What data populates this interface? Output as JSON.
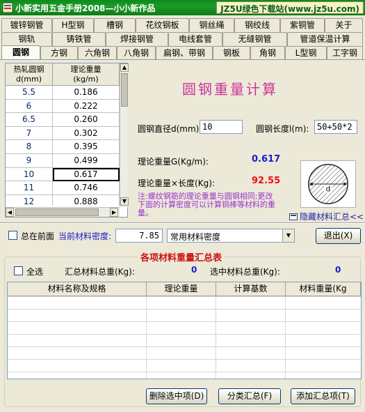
{
  "window": {
    "title": "小新实用五金手册2008—小小新作品",
    "site_badge": "JZ5U绿色下载站(www.jz5u.com)"
  },
  "tabs": {
    "row1": [
      "镀锌钢管",
      "H型钢",
      "槽钢",
      "花纹钢板",
      "钢丝绳",
      "钢绞线",
      "紫铜管",
      "关于"
    ],
    "row2": [
      "钢轨",
      "铸铁管",
      "焊接钢管",
      "电线套管",
      "无缝钢管",
      "管道保温计算"
    ],
    "row3": [
      "圆钢",
      "方钢",
      "六角钢",
      "八角钢",
      "扁钢、带钢",
      "钢板",
      "角钢",
      "L型钢",
      "工字钢"
    ],
    "active": "圆钢"
  },
  "table": {
    "col1_header": "热轧圆钢\nd(mm)",
    "col2_header": "理论重量\n(kg/m)",
    "rows": [
      {
        "d": "5.5",
        "w": "0.186"
      },
      {
        "d": "6",
        "w": "0.222"
      },
      {
        "d": "6.5",
        "w": "0.260"
      },
      {
        "d": "7",
        "w": "0.302"
      },
      {
        "d": "8",
        "w": "0.395"
      },
      {
        "d": "9",
        "w": "0.499"
      },
      {
        "d": "10",
        "w": "0.617"
      },
      {
        "d": "11",
        "w": "0.746"
      },
      {
        "d": "12",
        "w": "0.888"
      }
    ],
    "selected_row": 6
  },
  "calculator": {
    "title": "圆钢重量计算",
    "diameter_label": "圆钢直径d(mm):",
    "diameter_value": "10",
    "length_label": "圆钢长度l(m):",
    "length_value": "50+50*2",
    "theory_label": "理论重量G(Kg/m):",
    "theory_value": "0.617",
    "total_label": "理论重量×长度(Kg):",
    "total_value": "92.55",
    "note": "注:螺纹钢筋的理论重量与圆钢相同;更改下面的计算密度可以计算铜棒等材料的重量。",
    "diagram_label": "d",
    "hide_summary": "隐藏材料汇总<<"
  },
  "density": {
    "always_on_top": "总在前面",
    "label": "当前材料密度:",
    "value": "7.85",
    "select_value": "常用材料密度",
    "exit": "退出(X)"
  },
  "summary": {
    "title": "各项材料重量汇总表",
    "select_all": "全选",
    "total_label": "汇总材料总重(Kg):",
    "total_value": "0",
    "selected_label": "选中材料总重(Kg):",
    "selected_value": "0",
    "columns": [
      "材料名称及规格",
      "理论重量",
      "计算基数",
      "材料重量(Kg"
    ],
    "buttons": {
      "delete": "删除选中项(D)",
      "categorize": "分类汇总(F)",
      "add": "添加汇总项(T)"
    }
  },
  "colors": {
    "title_green": "#1f9a2a",
    "calc_title": "#cc3399",
    "result_blue": "#1a1acc",
    "result_red": "#ee1111",
    "note_purple": "#9933cc",
    "summary_title": "#cc1111"
  }
}
